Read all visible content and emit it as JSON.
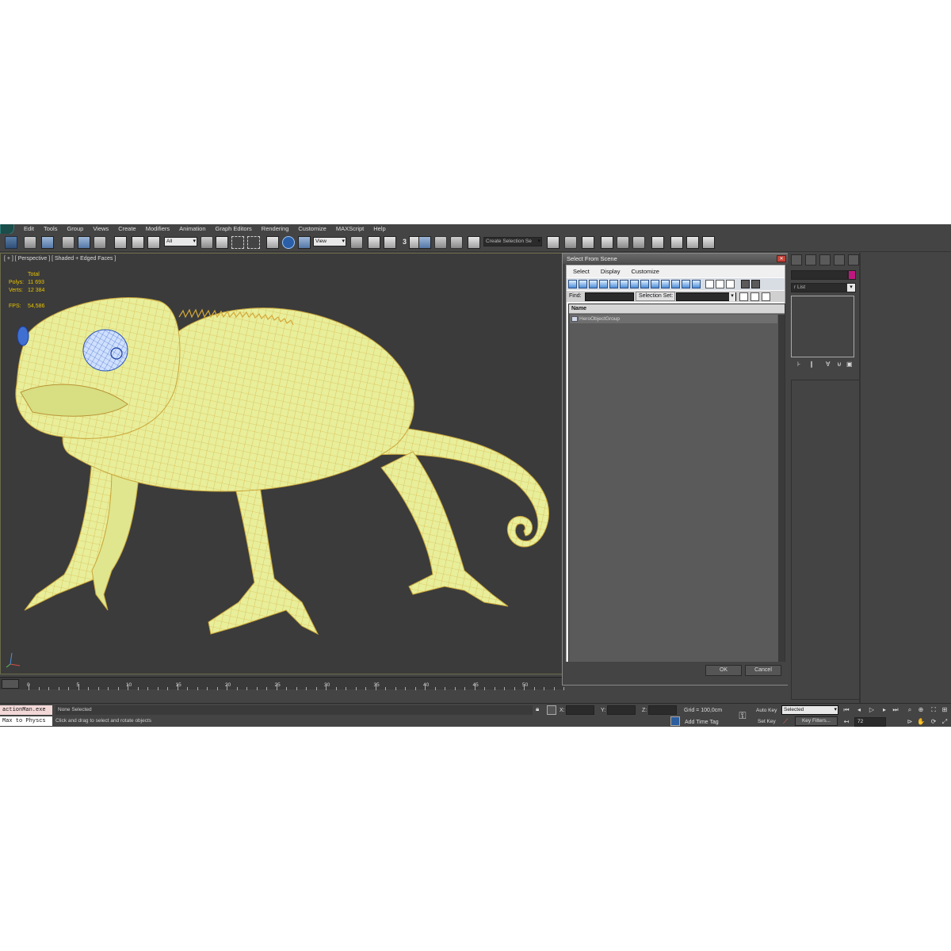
{
  "menu": {
    "items": [
      "Edit",
      "Tools",
      "Group",
      "Views",
      "Create",
      "Modifiers",
      "Animation",
      "Graph Editors",
      "Rendering",
      "Customize",
      "MAXScript",
      "Help"
    ]
  },
  "toolbar": {
    "selection_filter": "All",
    "reference_coord": "View",
    "snap_label": "3",
    "named_selection_placeholder": "Create Selection Se"
  },
  "viewport": {
    "label": "[ + ] [ Perspective ] [ Shaded + Edged Faces ]",
    "stats": {
      "header": "Total",
      "polys_label": "Polys:",
      "polys_value": "11 693",
      "verts_label": "Verts:",
      "verts_value": "12 384",
      "fps_label": "FPS:",
      "fps_value": "54,586"
    }
  },
  "timeline": {
    "ticks": [
      "0",
      "5",
      "10",
      "15",
      "20",
      "25",
      "30",
      "35",
      "40",
      "45",
      "50"
    ]
  },
  "status": {
    "maxscript_line1": "actionMan.exe",
    "maxscript_line2": "Max to Physcs",
    "selection": "None Selected",
    "prompt": "Click and drag to select and rotate objects",
    "x_label": "X:",
    "y_label": "Y:",
    "z_label": "Z:",
    "grid": "Grid = 100,0cm",
    "add_time_tag": "Add Time Tag",
    "auto_key": "Auto Key",
    "set_key": "Set Key",
    "key_mode": "Selected",
    "key_filters": "Key Filters...",
    "frame": "72"
  },
  "command_panel": {
    "modifier_list": "r List"
  },
  "dialog": {
    "title": "Select From Scene",
    "menu": [
      "Select",
      "Display",
      "Customize"
    ],
    "find_label": "Find:",
    "selection_set_label": "Selection Set:",
    "column_name": "Name",
    "rows": [
      "HeroObjectGroup"
    ],
    "ok": "OK",
    "cancel": "Cancel"
  },
  "colors": {
    "model": "#e8ee9a",
    "wire": "#d4a93a",
    "eye": "#3f6fd0",
    "stats_text": "#e6c200",
    "viewport_bg": "#3b3b3b"
  }
}
